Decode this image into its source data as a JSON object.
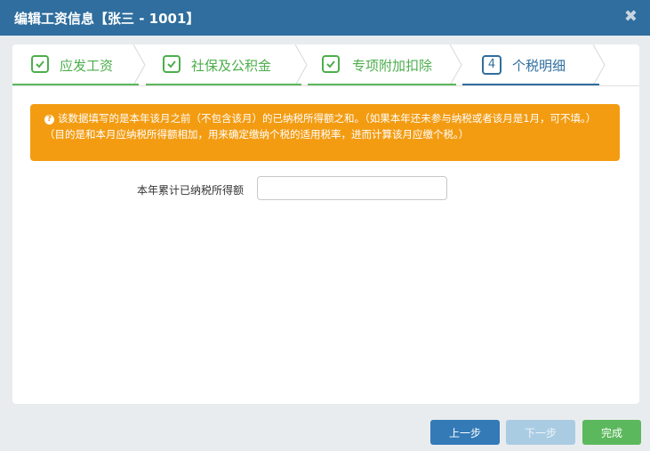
{
  "dialog": {
    "title": "编辑工资信息【张三 - 1001】",
    "close_symbol": "✖"
  },
  "steps": [
    {
      "label": "应发工资",
      "state": "done"
    },
    {
      "label": "社保及公积金",
      "state": "done"
    },
    {
      "label": "专项附加扣除",
      "state": "done"
    },
    {
      "label": "个税明细",
      "state": "active",
      "number": "4"
    }
  ],
  "notice": {
    "icon": "question-icon",
    "text": "该数据填写的是本年该月之前（不包含该月）的已纳税所得额之和。（如果本年还未参与纳税或者该月是1月，可不填。）（目的是和本月应纳税所得额相加，用来确定缴纳个税的适用税率，进而计算该月应缴个税。）"
  },
  "form": {
    "label": "本年累计已纳税所得额",
    "value": "",
    "placeholder": ""
  },
  "footer": {
    "prev_label": "上一步",
    "next_label": "下一步",
    "done_label": "完成"
  },
  "colors": {
    "titlebar": "#2f6e9e",
    "done_green": "#4cae4c",
    "active_blue": "#2f6e9e",
    "notice_orange": "#f39c12"
  }
}
